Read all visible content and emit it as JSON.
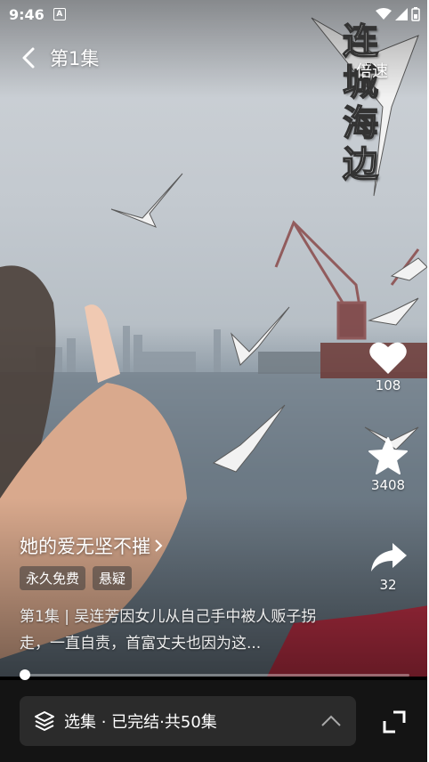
{
  "status_bar": {
    "time": "9:46",
    "notif_glyph": "A",
    "icons": [
      "wifi-icon",
      "signal-icon",
      "battery-icon"
    ]
  },
  "nav": {
    "episode": "第1集"
  },
  "watermark": {
    "text": "连城海边",
    "speed_label": "倍速"
  },
  "actions": {
    "like_count": "108",
    "favorite_count": "3408",
    "share_count": "32"
  },
  "drama": {
    "name": "她的爱无坚不摧",
    "tags": [
      "永久免费",
      "悬疑"
    ],
    "description": "第1集 | 吴连芳因女儿从自己手中被人贩子拐走，一直自责，首富丈夫也因为这..."
  },
  "progress": {
    "fraction": 0.01
  },
  "episode_bar": {
    "label": "选集 · 已完结·共50集"
  },
  "colors": {
    "bottom_bg": "#141414",
    "bar_bg": "#2b2b2b",
    "accent": "#ffffff"
  }
}
